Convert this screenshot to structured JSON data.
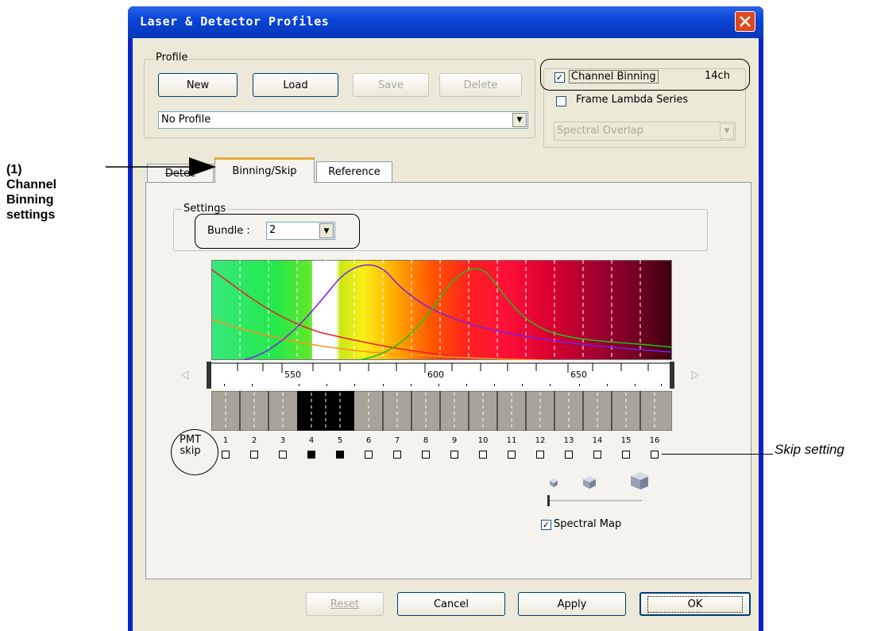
{
  "window": {
    "title": "Laser & Detector Profiles",
    "close_icon": "close-icon"
  },
  "profile": {
    "group_label": "Profile",
    "new_label": "New",
    "load_label": "Load",
    "save_label": "Save",
    "delete_label": "Delete",
    "selected": "No Profile"
  },
  "options": {
    "channel_binning_label": "Channel Binning",
    "channel_binning_checked": true,
    "channel_binning_value": "14ch",
    "frame_lambda_label": "Frame Lambda Series",
    "frame_lambda_checked": false,
    "spectral_select": "Spectral Overlap"
  },
  "tabs": [
    {
      "label": "Detec"
    },
    {
      "label": "Binning/Skip"
    },
    {
      "label": "Reference"
    }
  ],
  "settings": {
    "group_label": "Settings",
    "bundle_label": "Bundle :",
    "bundle_value": "2"
  },
  "spectrum": {
    "ruler_ticks": [
      "550",
      "600",
      "650"
    ]
  },
  "pmt": {
    "label_line1": "PMT",
    "label_line2": "skip",
    "channels": [
      "1",
      "2",
      "3",
      "4",
      "5",
      "6",
      "7",
      "8",
      "9",
      "10",
      "11",
      "12",
      "13",
      "14",
      "15",
      "16"
    ],
    "skipped": [
      false,
      false,
      false,
      true,
      true,
      false,
      false,
      false,
      false,
      false,
      false,
      false,
      false,
      false,
      false,
      false
    ]
  },
  "spectral_map": {
    "label": "Spectral Map",
    "checked": true
  },
  "footer": {
    "reset_label": "Reset",
    "cancel_label": "Cancel",
    "apply_label": "Apply",
    "ok_label": "OK"
  },
  "annotations": {
    "binning_line1": "(1)",
    "binning_line2": "Channel",
    "binning_line3": "Binning",
    "binning_line4": "settings",
    "skip_setting": "Skip setting"
  }
}
